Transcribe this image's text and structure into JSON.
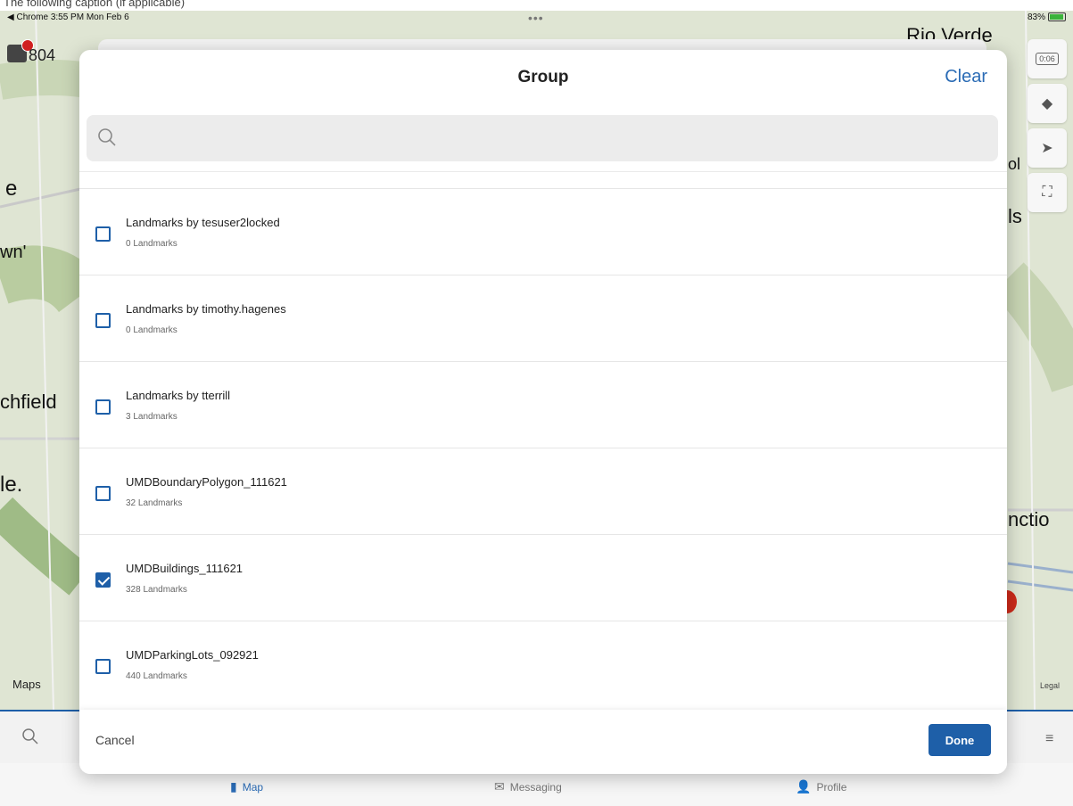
{
  "caption": "The following caption (if applicable)",
  "status_bar": {
    "left": "◀ Chrome  3:55 PM  Mon Feb 6",
    "dots": "•••",
    "battery": "83%"
  },
  "map": {
    "labels": {
      "rio_verde": ".Rio Verde",
      "left_e": "e",
      "left_wn": "wn'",
      "left_chfield": "chfield",
      "left_le": "le.",
      "right_ol": "ol",
      "right_ls": "ls",
      "right_nction": "nctio"
    },
    "vehicle": "804",
    "apple_maps": "Maps",
    "legal": "Legal",
    "timer": "0:06"
  },
  "modal": {
    "title": "Group",
    "clear": "Clear",
    "search_placeholder": "",
    "cancel": "Cancel",
    "done": "Done",
    "rows": [
      {
        "title": "Landmarks by tesuser2locked",
        "sub": "0 Landmarks",
        "checked": false
      },
      {
        "title": "Landmarks by timothy.hagenes",
        "sub": "0 Landmarks",
        "checked": false
      },
      {
        "title": "Landmarks by tterrill",
        "sub": "3 Landmarks",
        "checked": false
      },
      {
        "title": "UMDBoundaryPolygon_111621",
        "sub": "32 Landmarks",
        "checked": false
      },
      {
        "title": "UMDBuildings_111621",
        "sub": "328 Landmarks",
        "checked": true
      },
      {
        "title": "UMDParkingLots_092921",
        "sub": "440 Landmarks",
        "checked": false
      }
    ]
  },
  "tabs": {
    "map": "Map",
    "messaging": "Messaging",
    "profile": "Profile"
  },
  "colors": {
    "accent": "#1e5fa8",
    "link": "#2a6bb5"
  }
}
